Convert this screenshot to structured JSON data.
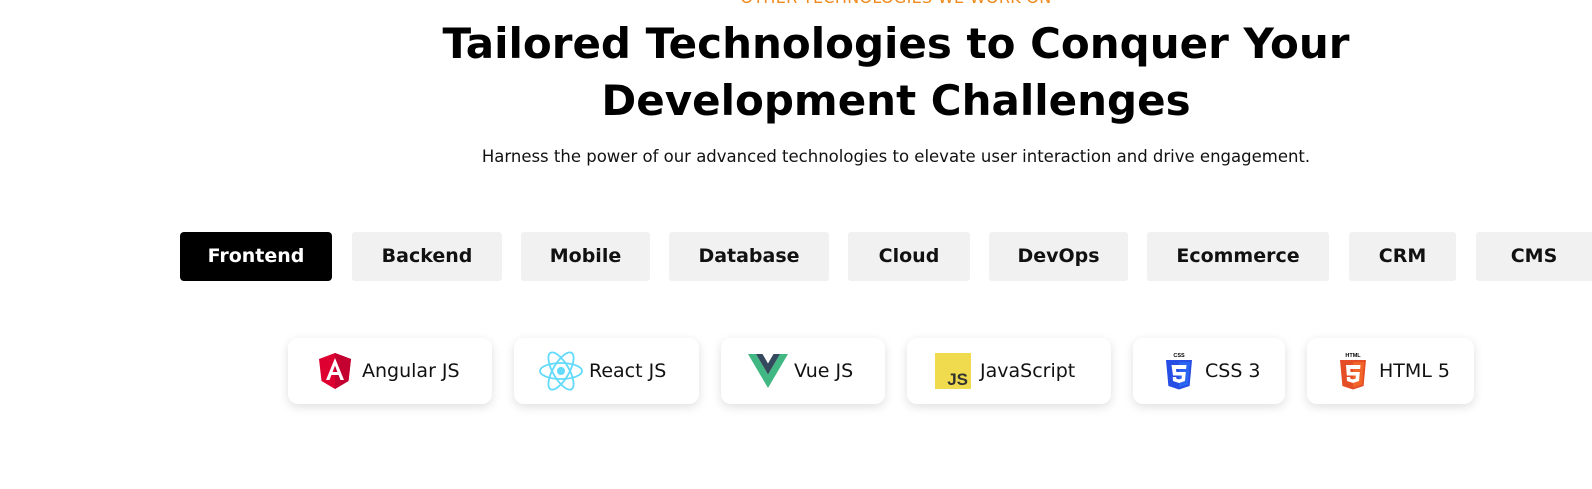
{
  "section": {
    "eyebrow": "OTHER TECHNOLOGIES WE WORK ON",
    "title_line1": "Tailored Technologies to Conquer Your",
    "title_line2": "Development Challenges",
    "subtitle": "Harness the power of our advanced technologies to elevate user interaction and drive engagement."
  },
  "tabs": [
    {
      "label": "Frontend",
      "active": true
    },
    {
      "label": "Backend"
    },
    {
      "label": "Mobile"
    },
    {
      "label": "Database"
    },
    {
      "label": "Cloud"
    },
    {
      "label": "DevOps"
    },
    {
      "label": "Ecommerce"
    },
    {
      "label": "CRM"
    },
    {
      "label": "CMS"
    }
  ],
  "technologies": [
    {
      "label": "Angular JS",
      "icon": "angular-icon"
    },
    {
      "label": "React JS",
      "icon": "react-icon"
    },
    {
      "label": "Vue JS",
      "icon": "vue-icon"
    },
    {
      "label": "JavaScript",
      "icon": "javascript-icon",
      "icon_text": "JS"
    },
    {
      "label": "CSS 3",
      "icon": "css3-icon",
      "icon_text": "CSS"
    },
    {
      "label": "HTML 5",
      "icon": "html5-icon",
      "icon_text": "HTML"
    }
  ],
  "colors": {
    "accent": "#f08a1c",
    "active_tab_bg": "#000000",
    "tab_bg": "#f1f1f1",
    "angular": "#dd0031",
    "react": "#61dafb",
    "vue_green": "#41b883",
    "vue_dark": "#35495e",
    "javascript": "#f0db4f",
    "css3": "#264de4",
    "html5": "#e44d26"
  }
}
